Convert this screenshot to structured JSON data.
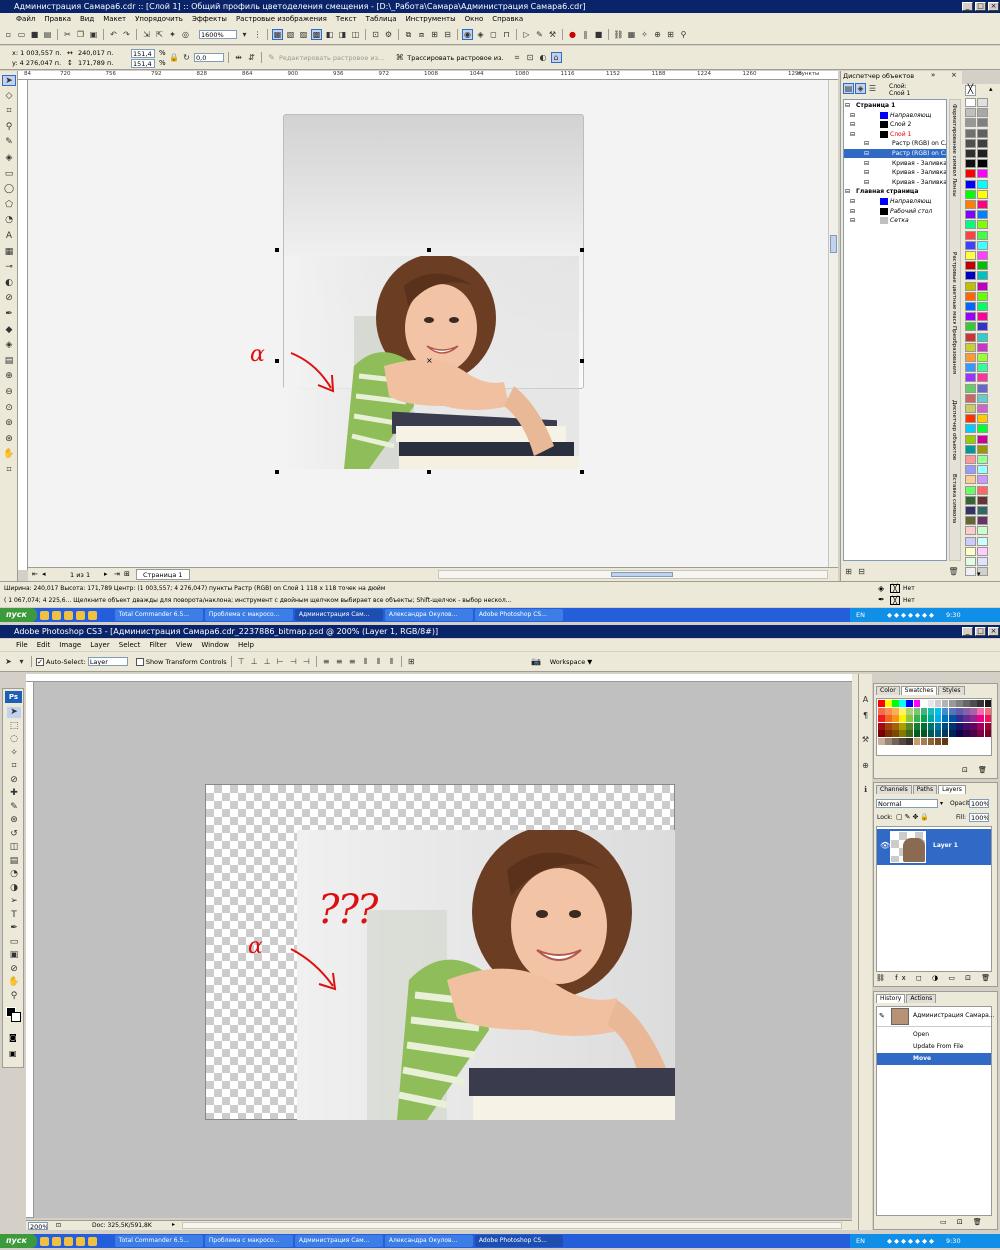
{
  "coreldraw": {
    "title": "Администрация Самара6.cdr :: [Слой 1] :: Общий профиль цветоделения смещения - [D:\\_Работа\\Самара\\Администрация Самара6.cdr]",
    "menu": [
      "Файл",
      "Правка",
      "Вид",
      "Макет",
      "Упорядочить",
      "Эффекты",
      "Растровые изображения",
      "Текст",
      "Таблица",
      "Инструменты",
      "Окно",
      "Справка"
    ],
    "zoom": "1600%",
    "props": {
      "x": "x: 1 003,557 п.",
      "y": "y: 4 276,047 п.",
      "w": "240,017 п.",
      "h": "171,789 п.",
      "sx": "151,4",
      "sy": "151,4",
      "pct": "%",
      "angle": "0,0"
    },
    "edit_bitmap": "Редактировать растровое из...",
    "trace_bitmap": "Трассировать растровое из.",
    "ruler_ticks": [
      "84",
      "720",
      "756",
      "792",
      "828",
      "864",
      "900",
      "936",
      "972",
      "1008",
      "1044",
      "1080",
      "1116",
      "1152",
      "1188",
      "1224",
      "1260",
      "1296",
      "пункты"
    ],
    "page_nav": {
      "count": "1 из 1",
      "tab": "Страница 1"
    },
    "status1": "Ширина: 240,017 Высота: 171,789 Центр: (1 003,557; 4 276,047) пункты        Растр (RGB) on Слой 1 118 x 118 точек на дюйм",
    "status2": "( 1 067,074; 4 225,6...  Щелкните объект дважды для поворота/наклона; инструмент с двойным щелчком выбирает все объекты; Shift-щелчок - выбор нескол...",
    "fill_none": "Нет",
    "outline_none": "Нет",
    "annotation_alpha": "α",
    "docker": {
      "title": "Диспетчер объектов",
      "header": [
        "Слой:",
        "Слой 1"
      ],
      "tree": [
        {
          "label": "Страница 1",
          "indent": 4,
          "bold": true
        },
        {
          "label": "Направляющ",
          "indent": 26,
          "italic": true,
          "swatch": "#0000ff"
        },
        {
          "label": "Слой 2",
          "indent": 26,
          "swatch": "#000000"
        },
        {
          "label": "Слой 1",
          "indent": 26,
          "red": true,
          "swatch": "#000000"
        },
        {
          "label": "Растр (RGB) on Сло",
          "indent": 40
        },
        {
          "label": "Растр (RGB) on Сло",
          "indent": 40,
          "selected": true
        },
        {
          "label": "Кривая - Заливка:",
          "indent": 40
        },
        {
          "label": "Кривая - Заливка:",
          "indent": 40
        },
        {
          "label": "Кривая - Заливка:",
          "indent": 40
        },
        {
          "label": "Главная страница",
          "indent": 4,
          "bold": true
        },
        {
          "label": "Направляющ",
          "indent": 26,
          "italic": true,
          "swatch": "#0000ff"
        },
        {
          "label": "Рабочий стол",
          "indent": 26,
          "italic": true,
          "swatch": "#000000"
        },
        {
          "label": "Сетка",
          "indent": 26,
          "italic": true,
          "swatch": "#c0c0c0"
        }
      ],
      "side_tabs": [
        "Форматирование символов",
        "Линзы",
        "Растровые цветные маски",
        "Преобразования",
        "Диспетчер объектов",
        "Вставка символа"
      ]
    }
  },
  "photoshop": {
    "title": "Adobe Photoshop CS3 - [Администрация Самара6.cdr_2237886_bitmap.psd @ 200% (Layer 1, RGB/8#)]",
    "menu": [
      "File",
      "Edit",
      "Image",
      "Layer",
      "Select",
      "Filter",
      "View",
      "Window",
      "Help"
    ],
    "options": {
      "auto_select": "Auto-Select:",
      "auto_select_value": "Layer",
      "transform": "Show Transform Controls",
      "workspace": "Workspace ▼"
    },
    "logo": "Ps",
    "panels": {
      "color_tabs": [
        "Color",
        "Swatches",
        "Styles"
      ],
      "layer_tabs": [
        "Channels",
        "Paths",
        "Layers"
      ],
      "blend_mode": "Normal",
      "opacity_label": "Opacity:",
      "opacity": "100%",
      "lock_label": "Lock:",
      "fill_label": "Fill:",
      "fill": "100%",
      "layer_name": "Layer 1",
      "history_tabs": [
        "History",
        "Actions"
      ],
      "history_doc": "Администрация Самара...",
      "history": [
        "Open",
        "Update From File",
        "Move"
      ]
    },
    "status": {
      "zoom": "200%",
      "doc": "Doc: 325,5K/591,8K"
    },
    "annotation_alpha": "α",
    "annotation_q": "???"
  },
  "taskbar": {
    "start": "пуск",
    "items": [
      "Total Commander 6.5...",
      "Проблема с макросо...",
      "Администрация Сам...",
      "Александра Окулов...",
      "Adobe Photoshop CS..."
    ],
    "lang": "EN",
    "clock": "9:30"
  },
  "colors": {
    "title_bar": "#0a246a",
    "taskbar": "#245edb",
    "start": "#3c9a3c",
    "annotation": "#dd1010",
    "selection": "#316ac5"
  }
}
